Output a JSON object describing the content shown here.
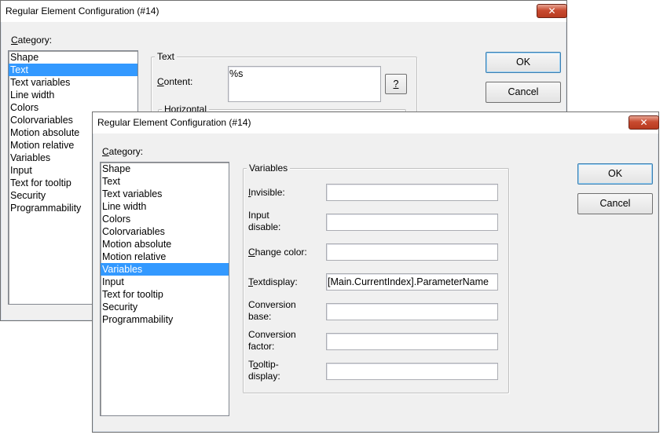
{
  "back_dialog": {
    "title": "Regular Element Configuration (#14)",
    "close_glyph": "✕",
    "category_label": "Category:",
    "category_items": [
      "Shape",
      "Text",
      "Text variables",
      "Line width",
      "Colors",
      "Colorvariables",
      "Motion absolute",
      "Motion relative",
      "Variables",
      "Input",
      "Text for tooltip",
      "Security",
      "Programmability"
    ],
    "selected_index": 1,
    "text_group_title": "Text",
    "content_label": "Content:",
    "content_value": "%s",
    "help_button": "?",
    "horizontal_label": "Horizontal",
    "ok_label": "OK",
    "cancel_label": "Cancel"
  },
  "front_dialog": {
    "title": "Regular Element Configuration (#14)",
    "close_glyph": "✕",
    "category_label": "Category:",
    "category_items": [
      "Shape",
      "Text",
      "Text variables",
      "Line width",
      "Colors",
      "Colorvariables",
      "Motion absolute",
      "Motion relative",
      "Variables",
      "Input",
      "Text for tooltip",
      "Security",
      "Programmability"
    ],
    "selected_index": 8,
    "variables_group_title": "Variables",
    "fields": [
      {
        "label_lines": [
          "Invisible:"
        ],
        "value": ""
      },
      {
        "label_lines": [
          "Input",
          "disable:"
        ],
        "value": ""
      },
      {
        "label_lines": [
          "Change color:"
        ],
        "value": ""
      },
      {
        "label_lines": [
          "Textdisplay:"
        ],
        "value": "[Main.CurrentIndex].ParameterName"
      },
      {
        "label_lines": [
          "Conversion",
          "base:"
        ],
        "value": ""
      },
      {
        "label_lines": [
          "Conversion",
          "factor:"
        ],
        "value": ""
      },
      {
        "label_lines": [
          "Tooltip-",
          "display:"
        ],
        "value": ""
      }
    ],
    "ok_label": "OK",
    "cancel_label": "Cancel"
  }
}
